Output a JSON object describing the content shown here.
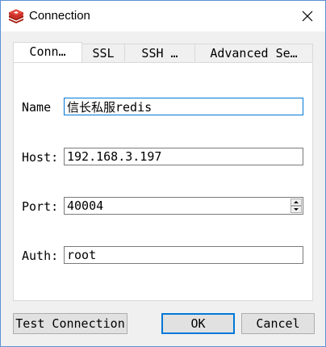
{
  "window": {
    "title": "Connection",
    "icon": "redis-icon",
    "close_icon": "close-icon"
  },
  "tabs": [
    {
      "label": "Conn…",
      "active": true
    },
    {
      "label": "SSL",
      "active": false
    },
    {
      "label": "SSH …",
      "active": false
    },
    {
      "label": "Advanced Se…",
      "active": false
    }
  ],
  "form": {
    "name": {
      "label": "Name",
      "value": "信长私服redis"
    },
    "host": {
      "label": "Host:",
      "value": "192.168.3.197"
    },
    "port": {
      "label": "Port:",
      "value": "40004"
    },
    "auth": {
      "label": "Auth:",
      "value": "root"
    }
  },
  "buttons": {
    "test": "Test Connection",
    "ok": "OK",
    "cancel": "Cancel"
  },
  "colors": {
    "accent": "#0078d7",
    "redis_red": "#d82c20"
  }
}
